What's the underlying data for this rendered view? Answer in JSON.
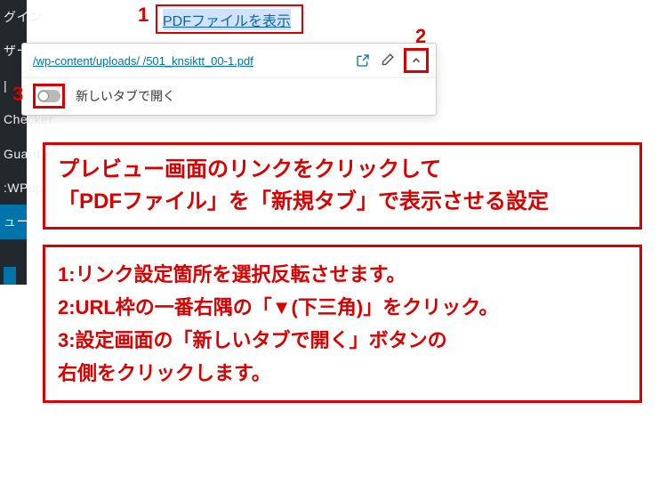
{
  "sidebar": {
    "items": [
      "グイン",
      "ザー",
      "|",
      "Checker",
      "Guard",
      ":WPup",
      "ューを"
    ]
  },
  "annotations": {
    "marker1": "1",
    "marker2": "2",
    "marker3": "3"
  },
  "link_editor": {
    "selected_text": "PDFファイルを表示",
    "url": "/wp-content/uploads/              /501_knsiktt_00-1.pdf",
    "open_new_tab_label": "新しいタブで開く"
  },
  "callout1": {
    "line1": "プレビュー画面のリンクをクリックして",
    "line2": "「PDFファイル」を「新規タブ」で表示させる設定"
  },
  "callout2": {
    "line1": "1:リンク設定箇所を選択反転させます。",
    "line2": "2:URL枠の一番右隅の「▼(下三角)」をクリック。",
    "line3": "3:設定画面の「新しいタブで開く」ボタンの",
    "line4": "右側をクリックします。"
  }
}
